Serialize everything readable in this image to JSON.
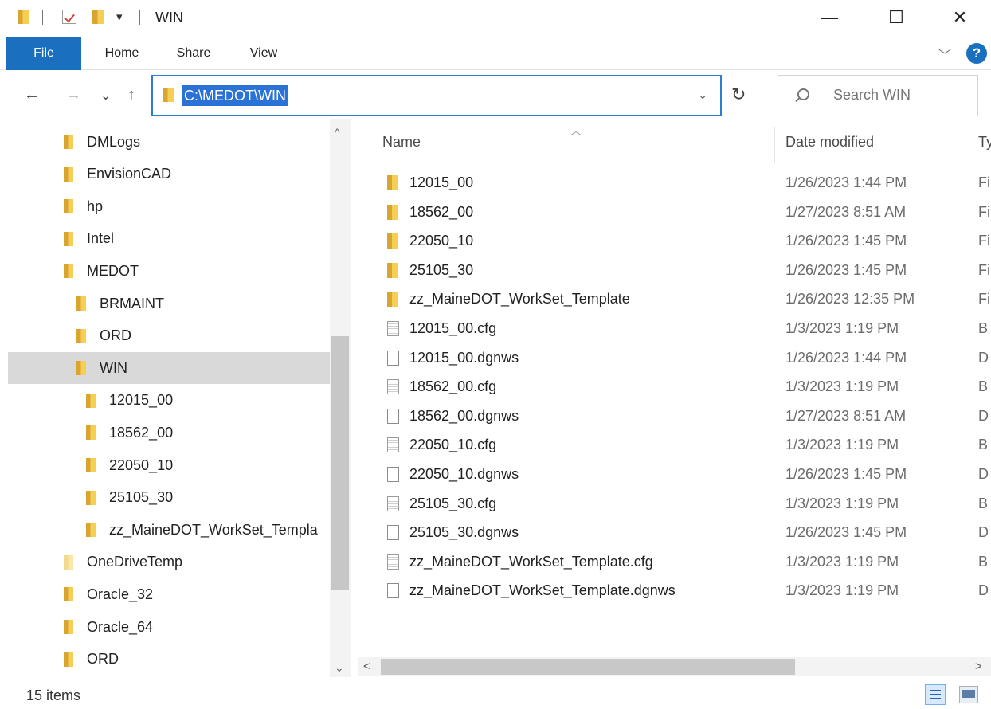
{
  "window": {
    "title": "WIN",
    "qat_dropdown": "▾",
    "minimize": "—",
    "maximize": "☐",
    "close": "✕"
  },
  "ribbon": {
    "tabs": [
      "File",
      "Home",
      "Share",
      "View"
    ],
    "expand": "﹀",
    "help": "?"
  },
  "nav": {
    "back": "←",
    "forward": "→",
    "recent": "⌄",
    "up": "↑",
    "address": "C:\\MEDOT\\WIN",
    "address_dropdown": "⌄",
    "refresh": "↻",
    "search_placeholder": "Search WIN"
  },
  "tree": [
    {
      "label": "DMLogs",
      "level": 0
    },
    {
      "label": "EnvisionCAD",
      "level": 0
    },
    {
      "label": "hp",
      "level": 0
    },
    {
      "label": "Intel",
      "level": 0
    },
    {
      "label": "MEDOT",
      "level": 0
    },
    {
      "label": "BRMAINT",
      "level": 1
    },
    {
      "label": "ORD",
      "level": 1
    },
    {
      "label": "WIN",
      "level": 1,
      "selected": true
    },
    {
      "label": "12015_00",
      "level": 2
    },
    {
      "label": "18562_00",
      "level": 2
    },
    {
      "label": "22050_10",
      "level": 2
    },
    {
      "label": "25105_30",
      "level": 2
    },
    {
      "label": "zz_MaineDOT_WorkSet_Templa",
      "level": 2
    },
    {
      "label": "OneDriveTemp",
      "level": 0,
      "light": true
    },
    {
      "label": "Oracle_32",
      "level": 0
    },
    {
      "label": "Oracle_64",
      "level": 0
    },
    {
      "label": "ORD",
      "level": 0
    }
  ],
  "columns": {
    "name": "Name",
    "date": "Date modified",
    "type": "Ty",
    "sort_indicator": "︿"
  },
  "files": [
    {
      "name": "12015_00",
      "date": "1/26/2023 1:44 PM",
      "type": "Fi",
      "kind": "folder"
    },
    {
      "name": "18562_00",
      "date": "1/27/2023 8:51 AM",
      "type": "Fi",
      "kind": "folder"
    },
    {
      "name": "22050_10",
      "date": "1/26/2023 1:45 PM",
      "type": "Fi",
      "kind": "folder"
    },
    {
      "name": "25105_30",
      "date": "1/26/2023 1:45 PM",
      "type": "Fi",
      "kind": "folder"
    },
    {
      "name": "zz_MaineDOT_WorkSet_Template",
      "date": "1/26/2023 12:35 PM",
      "type": "Fi",
      "kind": "folder"
    },
    {
      "name": "12015_00.cfg",
      "date": "1/3/2023 1:19 PM",
      "type": "B",
      "kind": "cfg"
    },
    {
      "name": "12015_00.dgnws",
      "date": "1/26/2023 1:44 PM",
      "type": "D",
      "kind": "file"
    },
    {
      "name": "18562_00.cfg",
      "date": "1/3/2023 1:19 PM",
      "type": "B",
      "kind": "cfg"
    },
    {
      "name": "18562_00.dgnws",
      "date": "1/27/2023 8:51 AM",
      "type": "D",
      "kind": "file"
    },
    {
      "name": "22050_10.cfg",
      "date": "1/3/2023 1:19 PM",
      "type": "B",
      "kind": "cfg"
    },
    {
      "name": "22050_10.dgnws",
      "date": "1/26/2023 1:45 PM",
      "type": "D",
      "kind": "file"
    },
    {
      "name": "25105_30.cfg",
      "date": "1/3/2023 1:19 PM",
      "type": "B",
      "kind": "cfg"
    },
    {
      "name": "25105_30.dgnws",
      "date": "1/26/2023 1:45 PM",
      "type": "D",
      "kind": "file"
    },
    {
      "name": "zz_MaineDOT_WorkSet_Template.cfg",
      "date": "1/3/2023 1:19 PM",
      "type": "B",
      "kind": "cfg"
    },
    {
      "name": "zz_MaineDOT_WorkSet_Template.dgnws",
      "date": "1/3/2023 1:19 PM",
      "type": "D",
      "kind": "file"
    }
  ],
  "status": {
    "item_count": "15 items"
  },
  "scroll": {
    "up": "^",
    "down": "⌄",
    "left": "<",
    "right": ">"
  },
  "colors": {
    "accent": "#1a6fbf",
    "selection": "#2a72d6",
    "folder": "#f5cf55"
  }
}
